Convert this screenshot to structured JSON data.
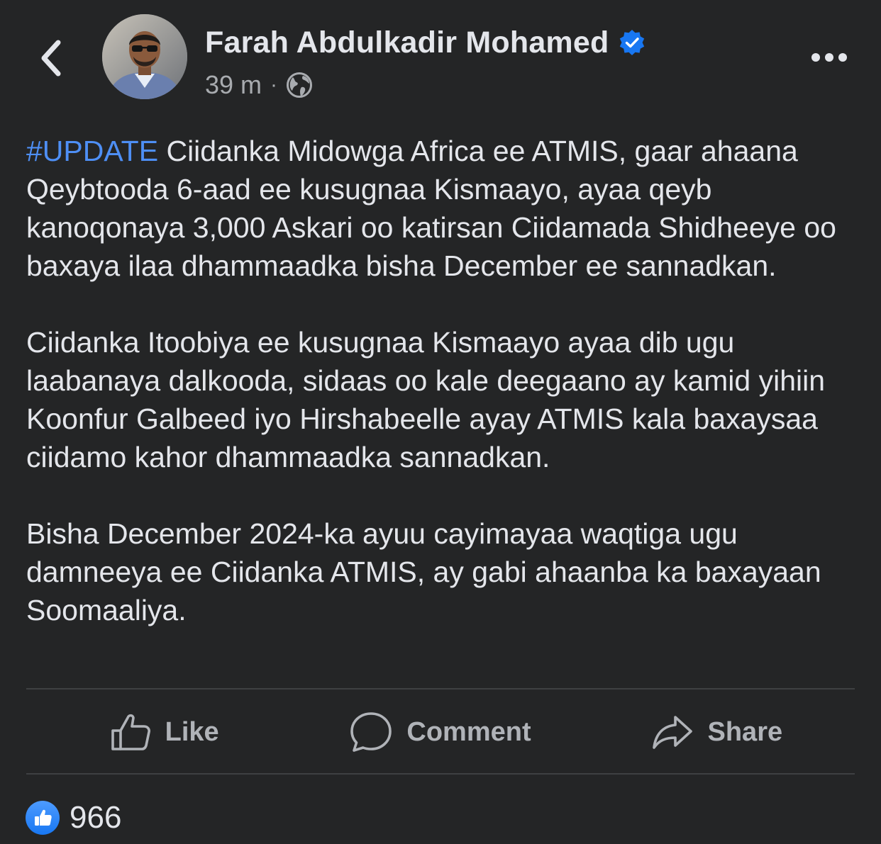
{
  "post": {
    "author": {
      "name": "Farah Abdulkadir Mohamed",
      "verified": true
    },
    "time": "39 m",
    "separator": "·",
    "audience_icon": "globe-icon",
    "hashtag": "#UPDATE",
    "paragraph_1_rest": " Ciidanka Midowga Africa ee ATMIS, gaar ahaana Qeybtooda 6-aad ee kusugnaa Kismaayo, ayaa qeyb kanoqonaya 3,000 Askari oo katirsan Ciidamada Shidheeye oo baxaya ilaa dhammaadka bisha December ee sannadkan.",
    "paragraph_2": "Ciidanka Itoobiya ee kusugnaa Kismaayo ayaa dib ugu laabanaya dalkooda, sidaas oo kale deegaano ay kamid yihiin Koonfur Galbeed iyo Hirshabeelle ayay ATMIS kala baxaysaa ciidamo kahor dhammaadka sannadkan.",
    "paragraph_3": "Bisha December 2024-ka ayuu cayimayaa waqtiga ugu damneeya ee Ciidanka ATMIS, ay gabi ahaanba ka baxayaan Soomaaliya."
  },
  "actions": {
    "like_label": "Like",
    "comment_label": "Comment",
    "share_label": "Share"
  },
  "reactions": {
    "count": "966"
  },
  "colors": {
    "background": "#242526",
    "text": "#e4e6eb",
    "secondary_text": "#b0b3b8",
    "hashtag": "#4e8ff5",
    "verified": "#1877f2",
    "divider": "#3e4042"
  },
  "icons": {
    "back": "chevron-left-icon",
    "verified": "verified-badge-icon",
    "more": "more-dots-icon",
    "like": "thumbs-up-icon",
    "comment": "comment-bubble-icon",
    "share": "share-arrow-icon"
  }
}
